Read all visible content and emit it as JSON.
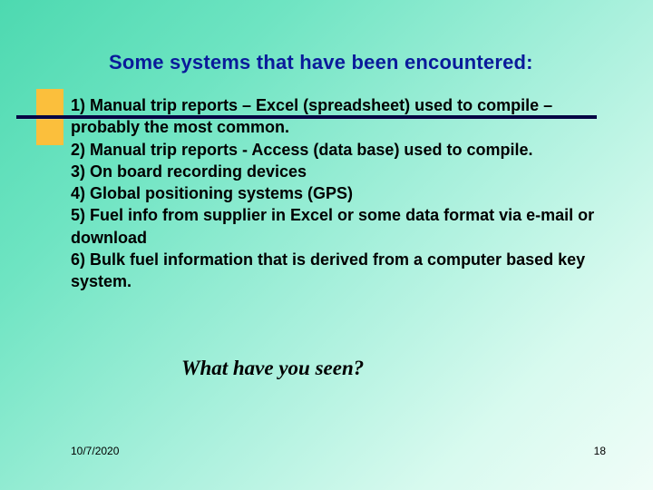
{
  "title": "Some systems that have been encountered:",
  "items": {
    "i1": "1) Manual trip reports – Excel (spreadsheet) used to compile – probably the most common.",
    "i2": "2) Manual trip reports - Access (data base) used to compile.",
    "i3": "3) On board recording devices",
    "i4": "4) Global positioning systems (GPS)",
    "i5": "5) Fuel info from supplier in Excel or some data format via e-mail or download",
    "i6": "6) Bulk fuel information that is derived from a computer based key system."
  },
  "question": "What have you seen?",
  "footer": {
    "date": "10/7/2020",
    "page": "18"
  }
}
